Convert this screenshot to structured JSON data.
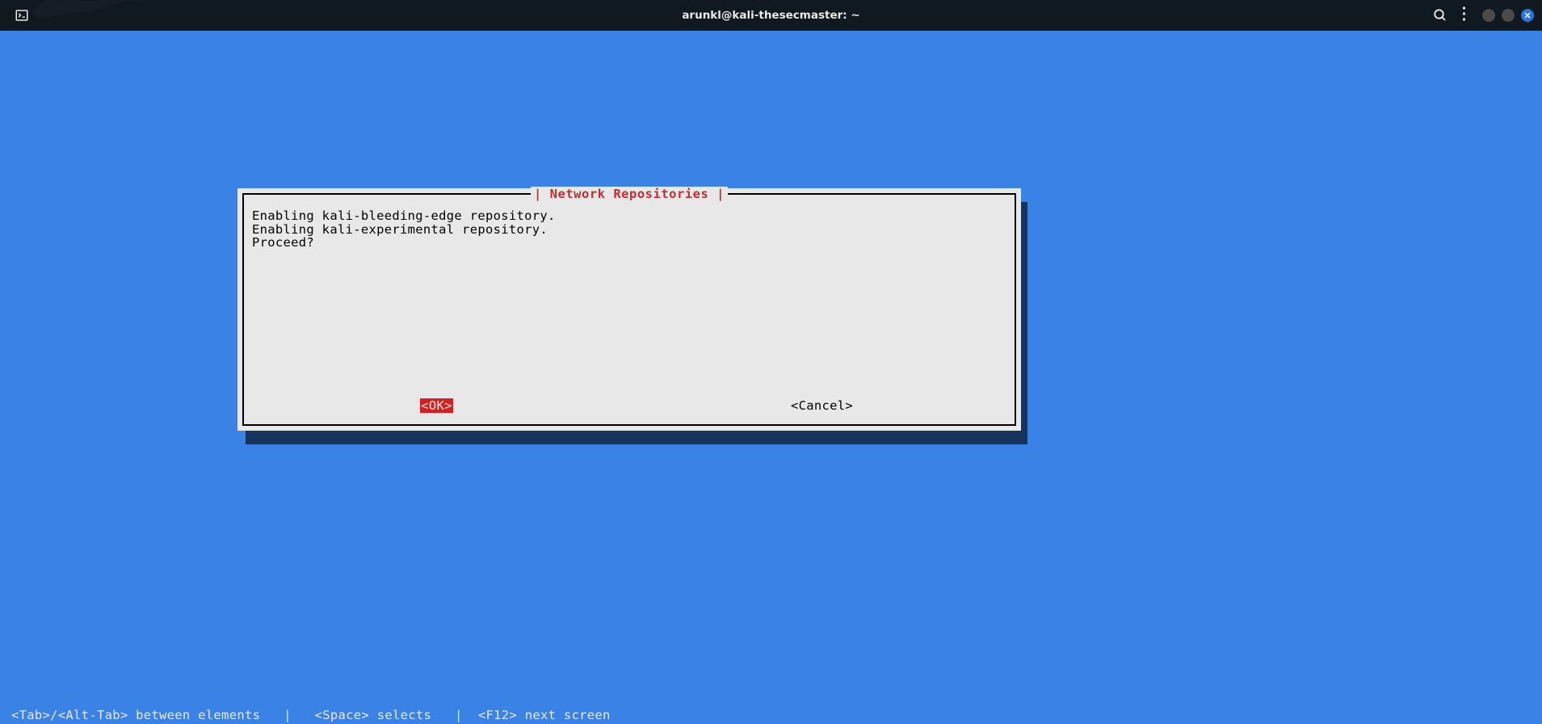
{
  "titlebar": {
    "title": "arunkl@kali-thesecmaster: ~"
  },
  "dialog": {
    "title": "| Network Repositories |",
    "content_line1": "Enabling kali-bleeding-edge repository.",
    "content_line2": "Enabling kali-experimental repository.",
    "content_line3": "Proceed?",
    "ok_label": "<OK>",
    "cancel_label": "<Cancel>"
  },
  "footer": {
    "hints": "<Tab>/<Alt-Tab> between elements   |   <Space> selects   |  <F12> next screen"
  },
  "icons": {
    "terminal": "terminal-icon",
    "search": "search-icon",
    "menu": "menu-icon",
    "minimize": "minimize-icon",
    "maximize": "maximize-icon",
    "close": "close-icon"
  }
}
